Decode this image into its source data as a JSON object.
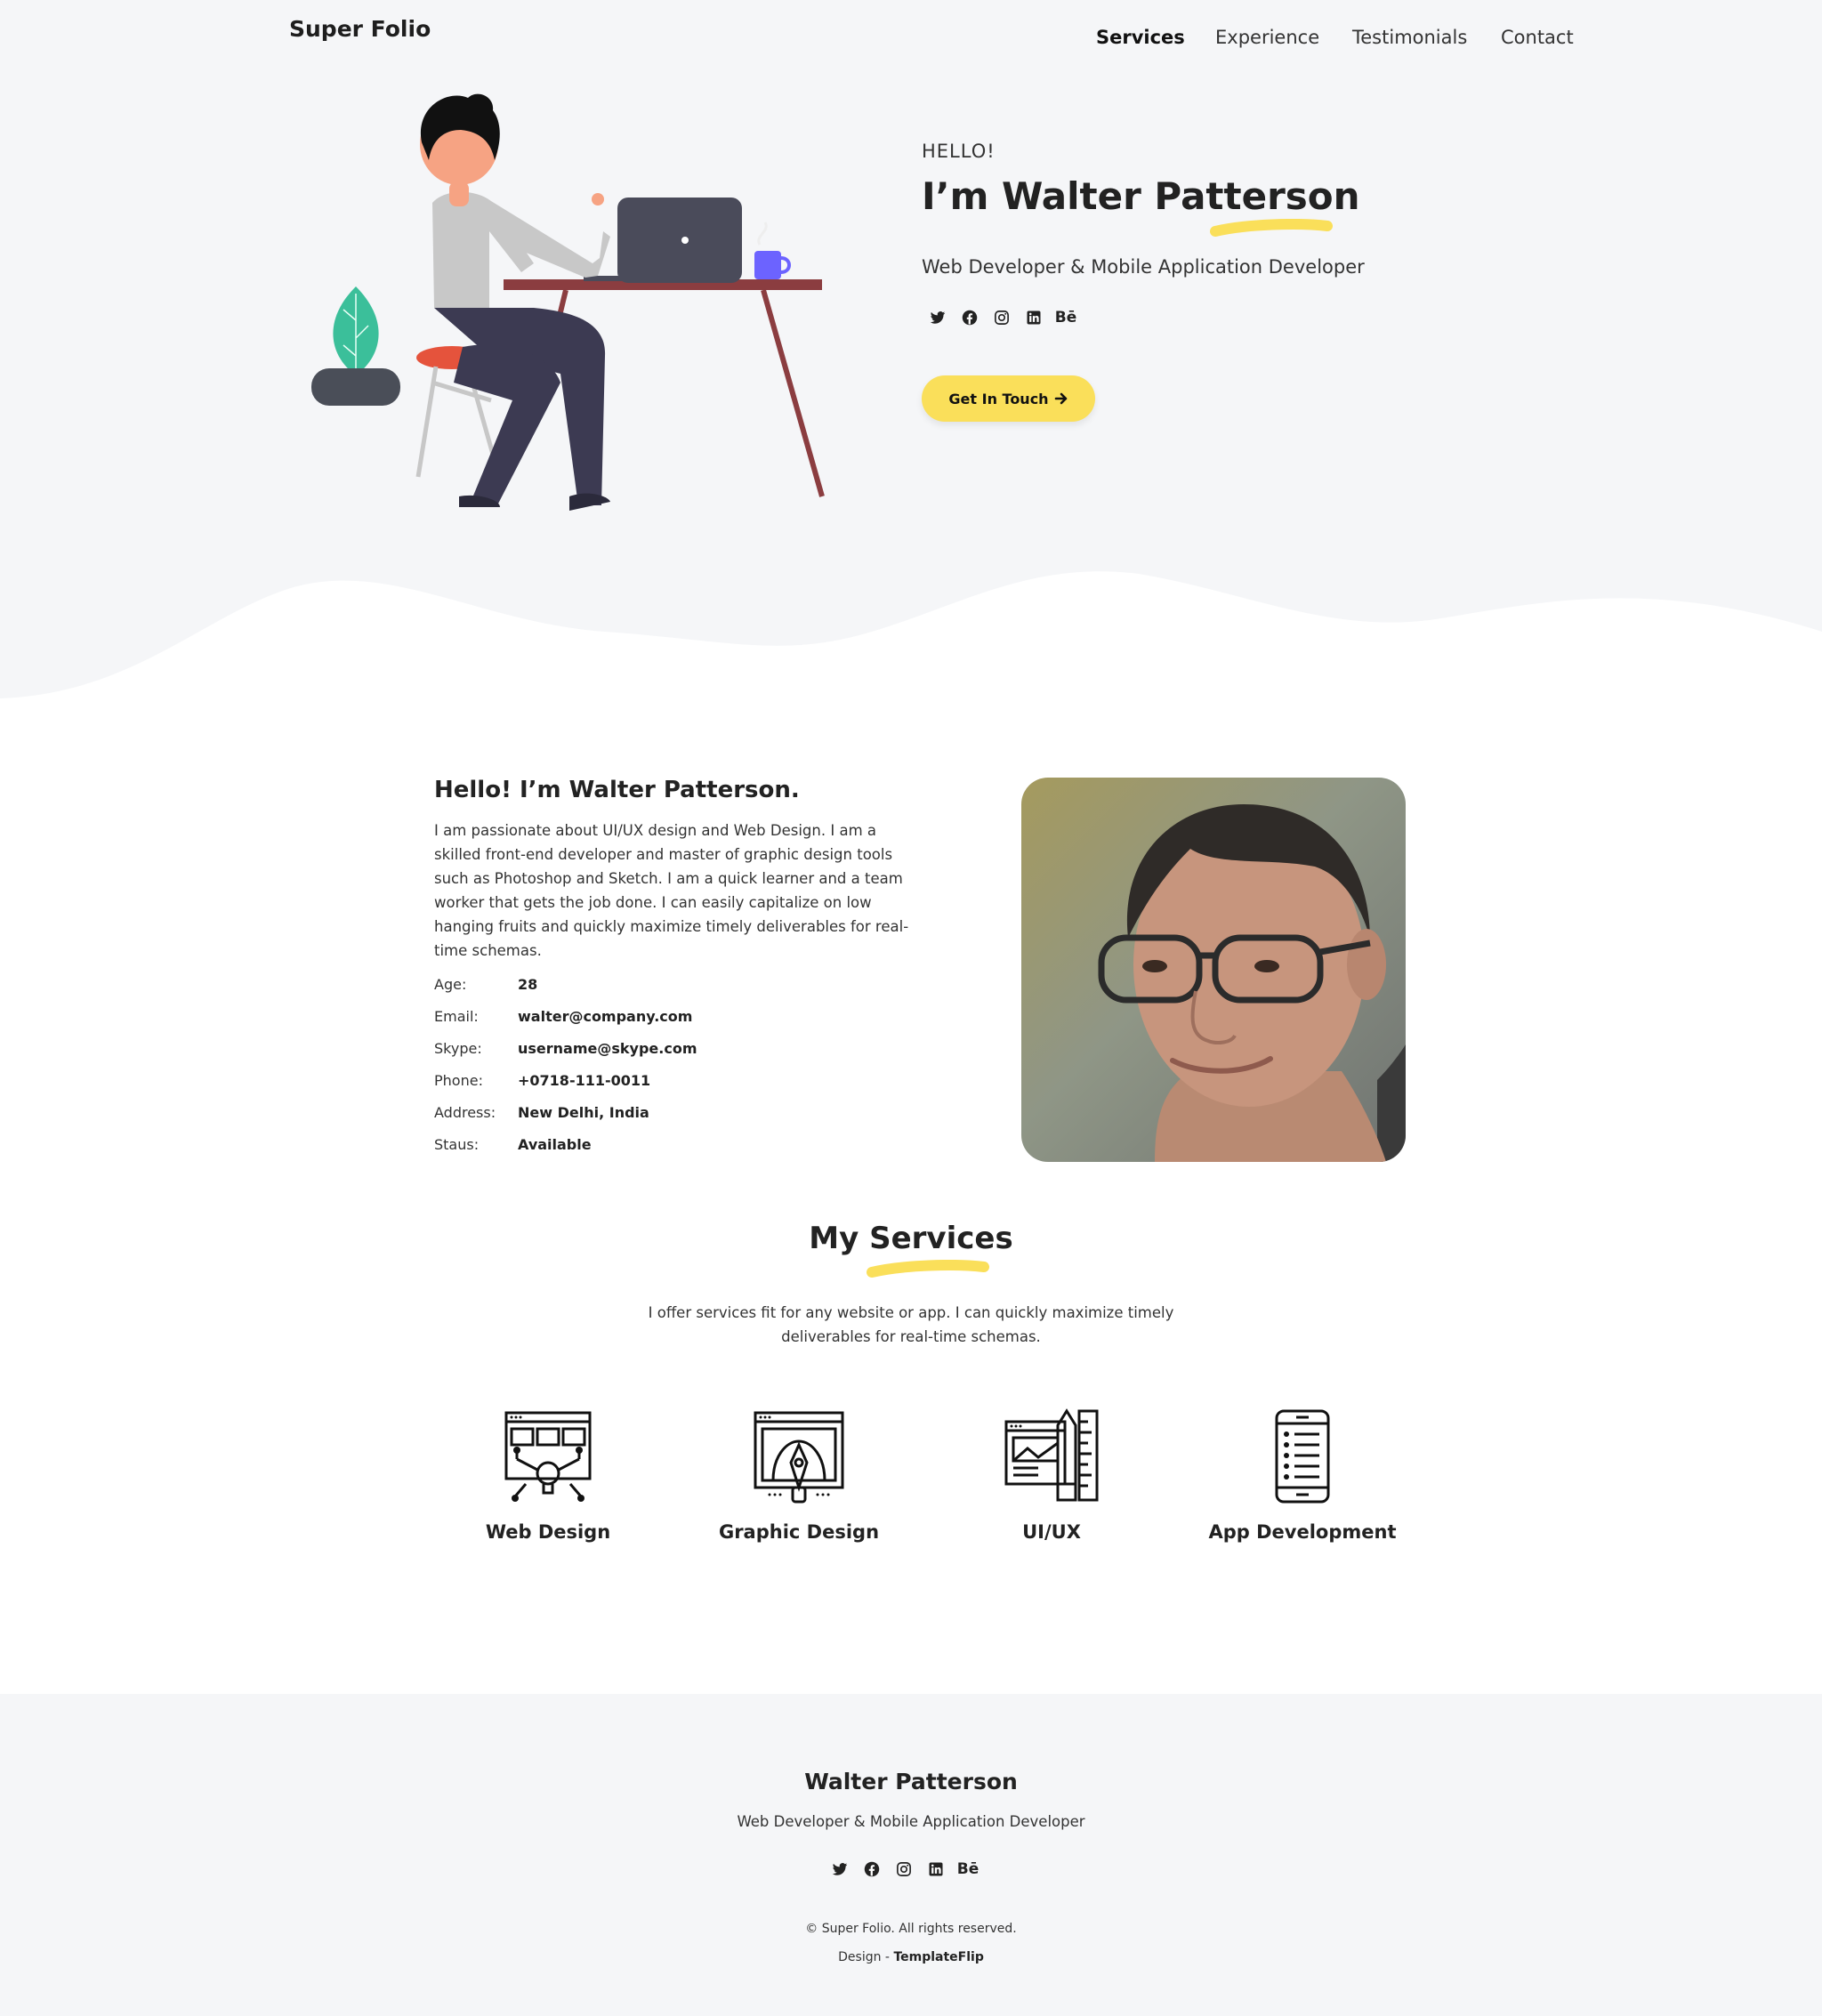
{
  "header": {
    "brand": "Super Folio",
    "nav": [
      {
        "label": "Services",
        "active": true
      },
      {
        "label": "Experience",
        "active": false
      },
      {
        "label": "Testimonials",
        "active": false
      },
      {
        "label": "Contact",
        "active": false
      }
    ]
  },
  "hero": {
    "greeting": "HELLO!",
    "name": "I’m Walter Patterson",
    "role": "Web Developer & Mobile Application Developer",
    "social_icons": [
      "twitter-icon",
      "facebook-icon",
      "instagram-icon",
      "linkedin-icon",
      "behance-icon"
    ],
    "behance_glyph": "Bē",
    "cta_label": "Get In Touch",
    "cta_icon": "arrow-right-icon"
  },
  "about": {
    "title": "Hello! I’m Walter Patterson.",
    "text": "I am passionate about UI/UX design and Web Design. I am a skilled front-end developer and master of graphic design tools such as Photoshop and Sketch. I am a quick learner and a team worker that gets the job done. I can easily capitalize on low hanging fruits and quickly maximize timely deliverables for real-time schemas.",
    "info": [
      {
        "label": "Age:",
        "value": "28"
      },
      {
        "label": "Email:",
        "value": "walter@company.com"
      },
      {
        "label": "Skype:",
        "value": "username@skype.com"
      },
      {
        "label": "Phone:",
        "value": "+0718-111-0011"
      },
      {
        "label": "Address:",
        "value": "New Delhi, India"
      },
      {
        "label": "Staus:",
        "value": "Available"
      }
    ]
  },
  "services": {
    "title": "My Services",
    "description": "I offer services fit for any website or app. I can quickly maximize timely deliverables for real-time schemas.",
    "items": [
      {
        "label": "Web Design",
        "icon": "web-design-icon"
      },
      {
        "label": "Graphic Design",
        "icon": "graphic-design-icon"
      },
      {
        "label": "UI/UX",
        "icon": "ui-ux-icon"
      },
      {
        "label": "App Development",
        "icon": "app-development-icon"
      }
    ]
  },
  "footer": {
    "name": "Walter Patterson",
    "role": "Web Developer & Mobile Application Developer",
    "copyright": "© Super Folio. All rights reserved.",
    "design_prefix": "Design - ",
    "design_credit": "TemplateFlip"
  },
  "colors": {
    "accent_yellow": "#fadf5a",
    "background_light": "#f5f6f8",
    "text_dark": "#222222"
  }
}
